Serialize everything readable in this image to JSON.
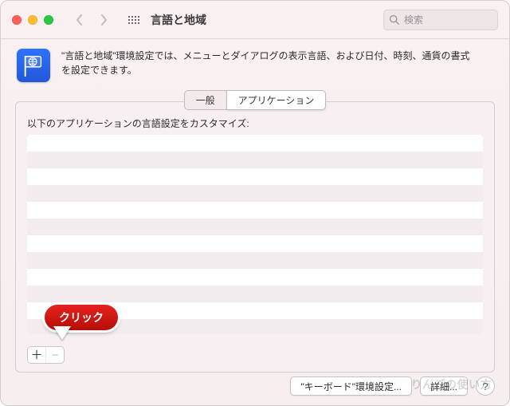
{
  "window": {
    "title": "言語と地域"
  },
  "search": {
    "placeholder": "検索"
  },
  "description": "\"言語と地域\"環境設定では、メニューとダイアログの表示言語、および日付、時刻、通貨の書式を設定できます。",
  "tabs": {
    "general": "一般",
    "applications": "アプリケーション"
  },
  "panel": {
    "label": "以下のアプリケーションの言語設定をカスタマイズ:"
  },
  "callout": {
    "text": "クリック"
  },
  "footer": {
    "keyboard_btn": "\"キーボード\"環境設定...",
    "advanced_btn": "詳細..."
  },
  "watermark": "りんごの使い方",
  "icons": {
    "globe": "globe-icon",
    "search": "search-icon",
    "back": "chevron-left-icon",
    "forward": "chevron-right-icon",
    "apps_grid": "apps-grid-icon",
    "plus": "plus-icon",
    "minus": "minus-icon",
    "help": "help-icon"
  }
}
